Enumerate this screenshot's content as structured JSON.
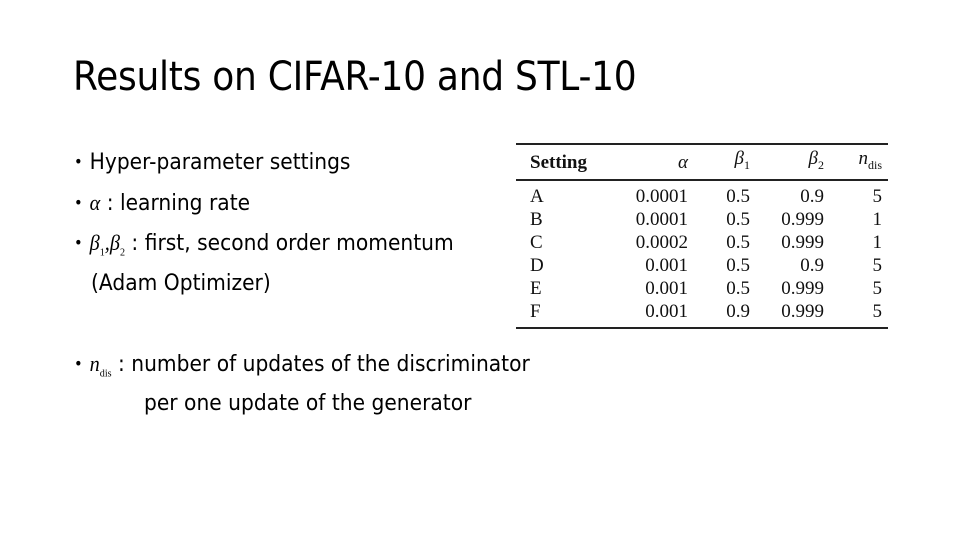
{
  "slide": {
    "title": "Results on CIFAR-10 and STL-10",
    "bullets": [
      {
        "symbol": "",
        "text": "Hyper-parameter settings"
      },
      {
        "symbol_base": "α",
        "text": " : learning rate"
      },
      {
        "symbol_base": "β",
        "symbol_sub1": "1",
        "symbol_sep": ",",
        "symbol_sub2": "2",
        "text": " : first, second order momentum"
      },
      {
        "continuation": "(Adam Optimizer)"
      },
      {
        "symbol_base": "n",
        "symbol_sub": "dis",
        "text": " : number of updates of the discriminator"
      },
      {
        "continuation": "per one update of the generator"
      }
    ],
    "bullet_glyph": "•"
  },
  "table": {
    "headers": {
      "setting": "Setting",
      "alpha": "α",
      "beta1_base": "β",
      "beta1_sub": "1",
      "beta2_base": "β",
      "beta2_sub": "2",
      "ndis_base": "n",
      "ndis_sub": "dis"
    },
    "rows": [
      {
        "setting": "A",
        "alpha": "0.0001",
        "beta1": "0.5",
        "beta2": "0.9",
        "ndis": "5"
      },
      {
        "setting": "B",
        "alpha": "0.0001",
        "beta1": "0.5",
        "beta2": "0.999",
        "ndis": "1"
      },
      {
        "setting": "C",
        "alpha": "0.0002",
        "beta1": "0.5",
        "beta2": "0.999",
        "ndis": "1"
      },
      {
        "setting": "D",
        "alpha": "0.001",
        "beta1": "0.5",
        "beta2": "0.9",
        "ndis": "5"
      },
      {
        "setting": "E",
        "alpha": "0.001",
        "beta1": "0.5",
        "beta2": "0.999",
        "ndis": "5"
      },
      {
        "setting": "F",
        "alpha": "0.001",
        "beta1": "0.9",
        "beta2": "0.999",
        "ndis": "5"
      }
    ]
  }
}
